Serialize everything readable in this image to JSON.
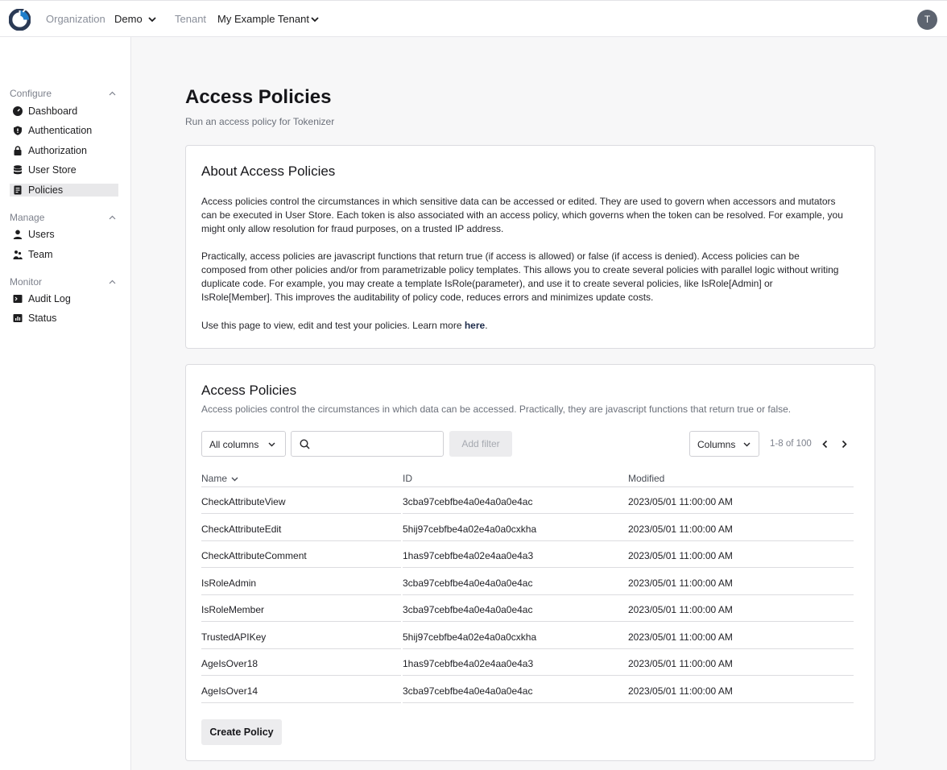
{
  "topbar": {
    "org_label": "Organization",
    "org_value": "Demo",
    "tenant_label": "Tenant",
    "tenant_value": "My Example Tenant",
    "avatar_initial": "T"
  },
  "sidebar": {
    "sections": [
      {
        "title": "Configure",
        "items": [
          {
            "label": "Dashboard",
            "icon": "gauge-icon"
          },
          {
            "label": "Authentication",
            "icon": "shield-icon"
          },
          {
            "label": "Authorization",
            "icon": "lock-icon"
          },
          {
            "label": "User Store",
            "icon": "database-icon"
          },
          {
            "label": "Policies",
            "icon": "document-icon",
            "active": true
          }
        ]
      },
      {
        "title": "Manage",
        "items": [
          {
            "label": "Users",
            "icon": "user-icon"
          },
          {
            "label": "Team",
            "icon": "team-icon"
          }
        ]
      },
      {
        "title": "Monitor",
        "items": [
          {
            "label": "Audit Log",
            "icon": "terminal-icon"
          },
          {
            "label": "Status",
            "icon": "bar-chart-icon"
          }
        ]
      }
    ]
  },
  "page": {
    "title": "Access Policies",
    "subtitle": "Run an access policy for Tokenizer"
  },
  "about": {
    "title": "About Access Policies",
    "para1": "Access policies control the circumstances in which sensitive data can be accessed or edited. They are used to govern when accessors and mutators can be executed in User Store. Each token is also associated with an access policy, which governs when the token can be resolved. For example, you might only allow resolution for fraud purposes, on a trusted IP address.",
    "para2": "Practically, access policies are javascript functions that return true (if access is allowed) or false (if access is denied). Access policies can be composed from other policies and/or from parametrizable policy templates. This allows you to create several policies with parallel logic without writing duplicate code. For example, you may create a template IsRole(parameter), and use it to create several policies, like IsRole[Admin] or IsRole[Member]. This improves the auditability of policy code, reduces errors and minimizes update costs.",
    "para3_prefix": "Use this page to view, edit and test your policies. Learn more ",
    "para3_link": "here",
    "para3_suffix": "."
  },
  "policies": {
    "title": "Access Policies",
    "subtitle": "Access policies control the circumstances in which data can be accessed. Practically, they are javascript functions that return true or false.",
    "filter_select": "All columns",
    "search_placeholder": "",
    "add_filter": "Add filter",
    "columns_button": "Columns",
    "pager_text": "1-8 of 100",
    "headers": {
      "name": "Name",
      "id": "ID",
      "modified": "Modified"
    },
    "rows": [
      {
        "name": "CheckAttributeView",
        "id": "3cba97cebfbe4a0e4a0a0e4ac",
        "modified": "2023/05/01 11:00:00 AM"
      },
      {
        "name": "CheckAttributeEdit",
        "id": "5hij97cebfbe4a02e4a0a0cxkha",
        "modified": "2023/05/01 11:00:00 AM"
      },
      {
        "name": "CheckAttributeComment",
        "id": "1has97cebfbe4a02e4aa0e4a3",
        "modified": "2023/05/01 11:00:00 AM"
      },
      {
        "name": "IsRoleAdmin",
        "id": "3cba97cebfbe4a0e4a0a0e4ac",
        "modified": "2023/05/01 11:00:00 AM"
      },
      {
        "name": "IsRoleMember",
        "id": "3cba97cebfbe4a0e4a0a0e4ac",
        "modified": "2023/05/01 11:00:00 AM"
      },
      {
        "name": "TrustedAPIKey",
        "id": "5hij97cebfbe4a02e4a0a0cxkha",
        "modified": "2023/05/01 11:00:00 AM"
      },
      {
        "name": "AgeIsOver18",
        "id": "1has97cebfbe4a02e4aa0e4a3",
        "modified": "2023/05/01 11:00:00 AM"
      },
      {
        "name": "AgeIsOver14",
        "id": "3cba97cebfbe4a0e4a0a0e4ac",
        "modified": "2023/05/01 11:00:00 AM"
      }
    ],
    "create_button": "Create Policy"
  },
  "colors": {
    "accent": "#1f7ecb",
    "logo_dark": "#2b3a55",
    "avatar": "#5d6470"
  }
}
